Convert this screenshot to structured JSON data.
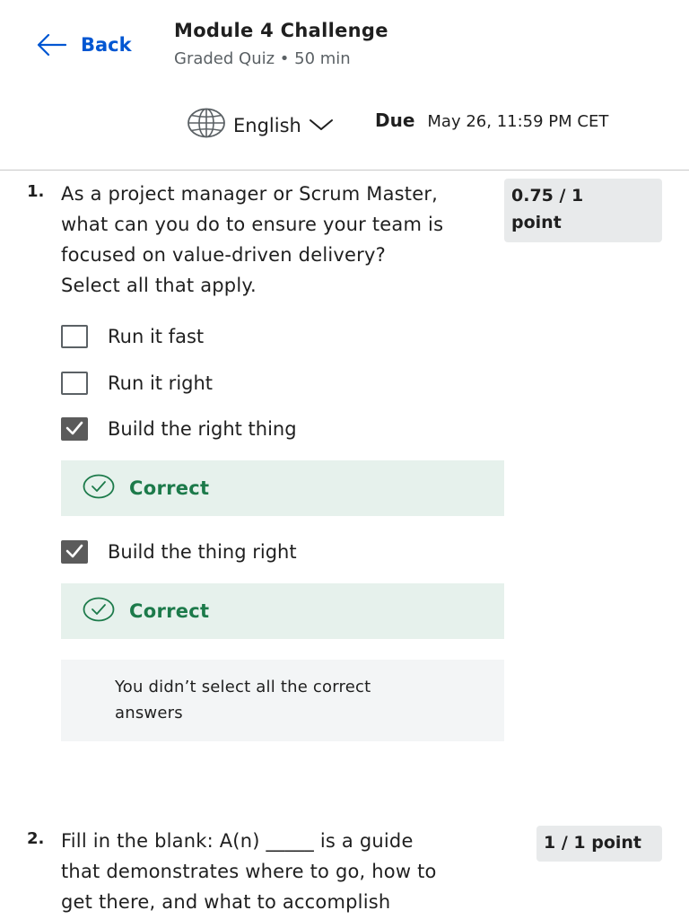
{
  "header": {
    "back_label": "Back",
    "title": "Module 4 Challenge",
    "subtitle": "Graded Quiz • 50 min",
    "language": "English",
    "due_label": "Due",
    "due_date": "May 26, 11:59 PM CET"
  },
  "questions": [
    {
      "number": "1.",
      "text_lines": [
        "As a project manager or Scrum Master,",
        "what can you do to ensure your team is",
        "focused on value-driven delivery?",
        "Select all that apply."
      ],
      "points_lines": [
        "0.75 / 1",
        "point"
      ],
      "options": [
        {
          "label": "Run it fast",
          "checked": false
        },
        {
          "label": "Run it right",
          "checked": false
        },
        {
          "label": "Build the right thing",
          "checked": true,
          "feedback": "Correct"
        },
        {
          "label": "Build the thing right",
          "checked": true,
          "feedback": "Correct"
        }
      ],
      "info_lines": [
        "You didn’t select all the correct",
        "answers"
      ]
    },
    {
      "number": "2.",
      "text_lines": [
        "Fill in the blank: A(n) _____ is a guide",
        "that demonstrates where to go, how to",
        "get there, and what to accomplish"
      ],
      "points": "1 / 1 point"
    }
  ],
  "colors": {
    "link": "#0056d2",
    "success": "#1c7a4a",
    "success_bg": "#e6f1ec",
    "points_bg": "#e8eaeb",
    "info_bg": "#f3f5f6"
  },
  "icons": [
    "arrow-left-icon",
    "globe-icon",
    "chevron-down-icon",
    "checkmark-icon",
    "check-circle-icon"
  ]
}
